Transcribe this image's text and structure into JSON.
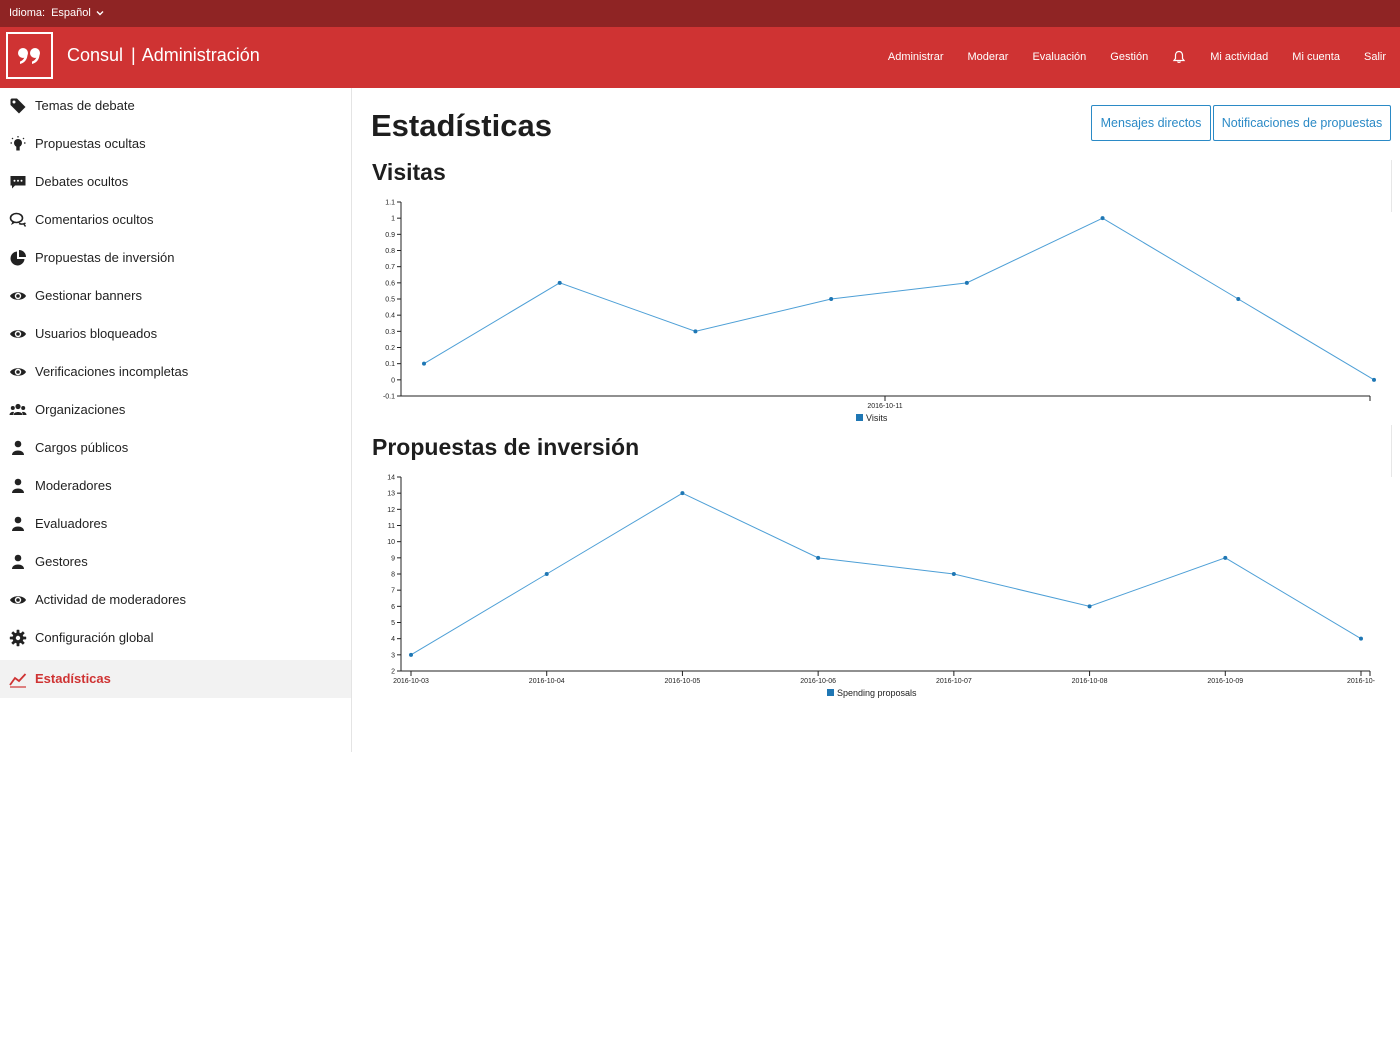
{
  "topbar": {
    "language_label": "Idioma:",
    "language_value": "Español"
  },
  "header": {
    "brand": "Consul",
    "separator": "|",
    "section": "Administración",
    "nav": [
      "Administrar",
      "Moderar",
      "Evaluación",
      "Gestión",
      "Mi actividad",
      "Mi cuenta",
      "Salir"
    ]
  },
  "sidebar": {
    "items": [
      {
        "label": "Temas de debate",
        "icon": "tag-icon"
      },
      {
        "label": "Propuestas ocultas",
        "icon": "lightbulb-icon"
      },
      {
        "label": "Debates ocultos",
        "icon": "chat-icon"
      },
      {
        "label": "Comentarios ocultos",
        "icon": "comments-icon"
      },
      {
        "label": "Propuestas de inversión",
        "icon": "pie-chart-icon"
      },
      {
        "label": "Gestionar banners",
        "icon": "eye-icon"
      },
      {
        "label": "Usuarios bloqueados",
        "icon": "eye-icon"
      },
      {
        "label": "Verificaciones incompletas",
        "icon": "eye-icon"
      },
      {
        "label": "Organizaciones",
        "icon": "users-icon"
      },
      {
        "label": "Cargos públicos",
        "icon": "user-icon"
      },
      {
        "label": "Moderadores",
        "icon": "user-icon"
      },
      {
        "label": "Evaluadores",
        "icon": "user-icon"
      },
      {
        "label": "Gestores",
        "icon": "user-icon"
      },
      {
        "label": "Actividad de moderadores",
        "icon": "eye-icon"
      },
      {
        "label": "Configuración global",
        "icon": "gear-icon"
      },
      {
        "label": "Estadísticas",
        "icon": "stats-icon",
        "active": true
      }
    ]
  },
  "main": {
    "title": "Estadísticas",
    "buttons": {
      "direct_messages": "Mensajes directos",
      "proposal_notifications": "Notificaciones de propuestas"
    }
  },
  "colors": {
    "accent": "#cf3333",
    "topbar": "#8f2424",
    "link": "#2b8ac6",
    "series": "#1f77b4",
    "line": "#4d9fd6"
  },
  "chart_data": [
    {
      "title": "Visitas",
      "type": "line",
      "x_tick_labels": [
        "2016-10-11"
      ],
      "ylim": [
        -0.1,
        1.1
      ],
      "y_ticks": [
        "-0.1",
        "0",
        "0.1",
        "0.2",
        "0.3",
        "0.4",
        "0.5",
        "0.6",
        "0.7",
        "0.8",
        "0.9",
        "1",
        "1.1"
      ],
      "series": [
        {
          "name": "Visits",
          "values": [
            0.1,
            0.6,
            0.3,
            0.5,
            0.6,
            1,
            0.5,
            0
          ]
        }
      ],
      "grid": false,
      "legend": "bottom-center"
    },
    {
      "title": "Propuestas de inversión",
      "type": "line",
      "categories": [
        "2016-10-03",
        "2016-10-04",
        "2016-10-05",
        "2016-10-06",
        "2016-10-07",
        "2016-10-08",
        "2016-10-09",
        "2016-10-"
      ],
      "ylim": [
        2,
        14
      ],
      "y_ticks": [
        "2",
        "3",
        "4",
        "5",
        "6",
        "7",
        "8",
        "9",
        "10",
        "11",
        "12",
        "13",
        "14"
      ],
      "series": [
        {
          "name": "Spending proposals",
          "values": [
            3,
            8,
            13,
            9,
            8,
            6,
            9,
            4
          ]
        }
      ],
      "grid": false,
      "legend": "bottom-center"
    }
  ]
}
